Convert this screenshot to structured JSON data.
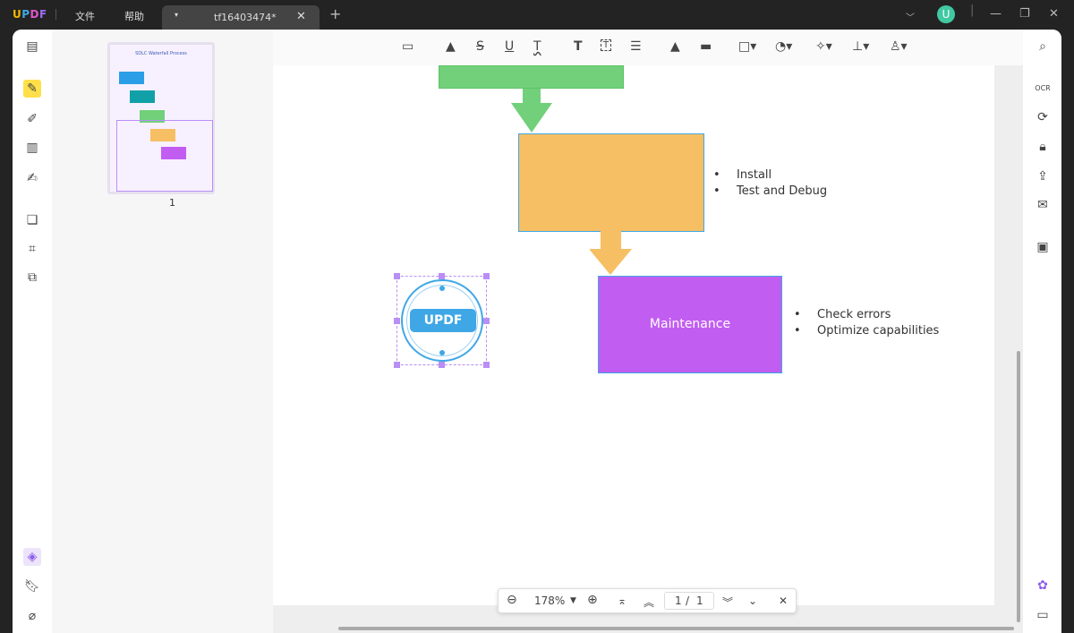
{
  "app": {
    "logo": "UPDF",
    "menu": [
      "文件",
      "帮助"
    ],
    "tab_title": "tf16403474*",
    "avatar_letter": "U"
  },
  "toolbar": {
    "tools": [
      "comment-icon",
      "highlight-icon",
      "strikethrough-icon",
      "underline-icon",
      "squiggly-icon",
      "text-icon",
      "textbox-icon",
      "text-callout-icon",
      "pencil-icon",
      "eraser-icon",
      "shape-icon",
      "sticker-icon",
      "pin-icon",
      "stamp-icon",
      "signature-icon"
    ]
  },
  "thumbnail": {
    "title": "SDLC Waterfall Process",
    "page_label": "1"
  },
  "document": {
    "colors": {
      "green": "#72d07a",
      "orange": "#f6bf63",
      "purple": "#c25df2",
      "border": "#3fa7e6"
    },
    "box_maintenance": "Maintenance",
    "bullets_install": [
      "Install",
      "Test and Debug"
    ],
    "bullets_maintenance": [
      "Check errors",
      "Optimize capabilities"
    ],
    "stamp_text": "UPDF"
  },
  "navbar": {
    "zoom": "178%",
    "current_page": "1",
    "separator": "/",
    "total_pages": "1"
  }
}
